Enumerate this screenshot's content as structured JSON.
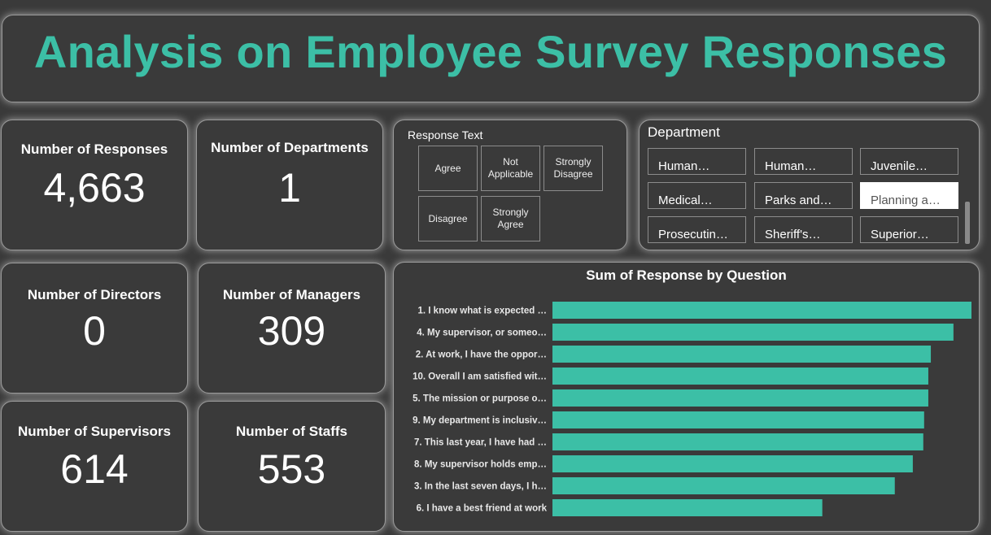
{
  "title": "Analysis on Employee Survey Responses",
  "kpis": {
    "responses": {
      "label": "Number of Responses",
      "value": "4,663"
    },
    "departments": {
      "label": "Number of Departments",
      "value": "1"
    },
    "directors": {
      "label": "Number of Directors",
      "value": "0"
    },
    "managers": {
      "label": "Number of Managers",
      "value": "309"
    },
    "supervisors": {
      "label": "Number of Supervisors",
      "value": "614"
    },
    "staffs": {
      "label": "Number of Staffs",
      "value": "553"
    }
  },
  "response_text": {
    "title": "Response Text",
    "options": [
      "Agree",
      "Not Applicable",
      "Strongly Disagree",
      "Disagree",
      "Strongly Agree"
    ]
  },
  "department": {
    "title": "Department",
    "options": [
      "Human…",
      "Human…",
      "Juvenile…",
      "Medical…",
      "Parks and…",
      "Planning a…",
      "Prosecutin…",
      "Sheriff's…",
      "Superior…"
    ],
    "selected": "Planning a…"
  },
  "colors": {
    "accent": "#3cbfa6",
    "background": "#3a3a3a"
  },
  "chart_data": {
    "type": "bar",
    "orientation": "horizontal",
    "title": "Sum of Response by Question",
    "categories": [
      "1. I know what is expected …",
      "4. My supervisor, or someo…",
      "2. At work, I have the oppor…",
      "10. Overall I am satisfied wit…",
      "5. The mission or purpose o…",
      "9. My department is inclusiv…",
      "7. This last year, I have had …",
      "8. My supervisor holds emp…",
      "3. In the last seven days, I h…",
      "6. I have a best friend at work"
    ],
    "values": [
      100,
      95.7,
      90.3,
      89.7,
      89.7,
      88.7,
      88.5,
      86.0,
      81.7,
      64.4
    ],
    "bar_color": "#3cbfa6",
    "grid": false
  }
}
